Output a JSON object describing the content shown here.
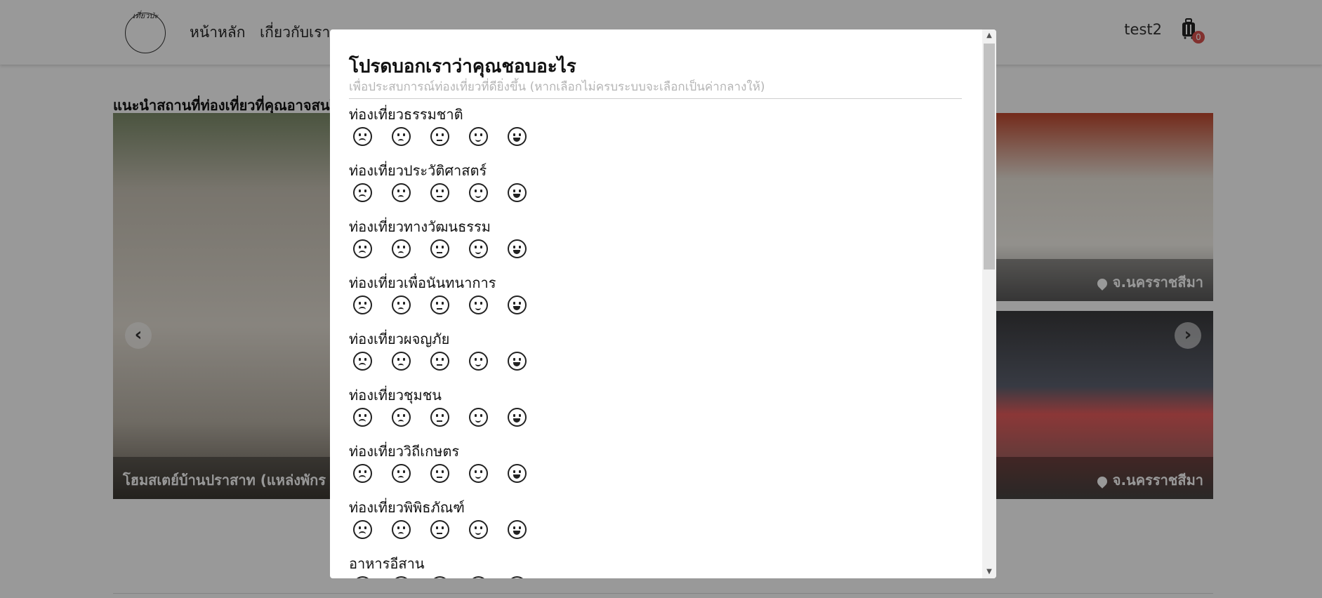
{
  "navbar": {
    "logo_text": "เที่ยวป่ะ",
    "links": [
      "หน้าหลัก",
      "เกี่ยวกับเรา"
    ],
    "user": "test2",
    "cart_count": "0"
  },
  "section_title": "แนะนำสถานที่ท่องเที่ยวที่คุณอาจสนใจ",
  "cards": {
    "left_caption": "โฮมสเตย์บ้านปราสาท (แหล่งพักร",
    "right_top_location": "จ.นครราชสีมา",
    "right_bottom_location": "จ.นครราชสีมา"
  },
  "modal": {
    "title": "โปรดบอกเราว่าคุณชอบอะไร",
    "subtitle": "เพื่อประสบการณ์ท่องเที่ยวที่ดียิ่งขึ้น (หากเลือกไม่ครบระบบจะเลือกเป็นค่ากลางให้)",
    "categories": [
      "ท่องเที่ยวธรรมชาติ",
      "ท่องเที่ยวประวัติศาสตร์",
      "ท่องเที่ยวทางวัฒนธรรม",
      "ท่องเที่ยวเพื่อนันทนาการ",
      "ท่องเที่ยวผจญภัย",
      "ท่องเที่ยวชุมชน",
      "ท่องเที่ยววิถีเกษตร",
      "ท่องเที่ยวพิพิธภัณฑ์",
      "อาหารอีสาน"
    ],
    "rating_icons": [
      "very-sad-face-icon",
      "sad-face-icon",
      "neutral-face-icon",
      "smile-face-icon",
      "grin-face-icon"
    ]
  }
}
